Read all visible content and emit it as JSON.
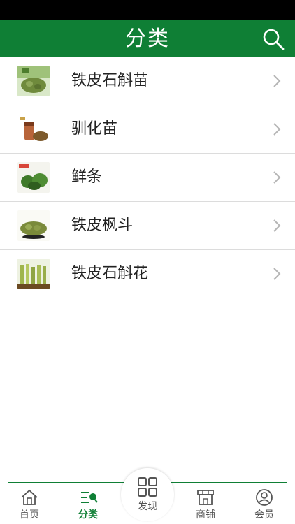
{
  "header": {
    "title": "分类"
  },
  "categories": [
    {
      "label": "铁皮石斛苗"
    },
    {
      "label": "驯化苗"
    },
    {
      "label": "鲜条"
    },
    {
      "label": "铁皮枫斗"
    },
    {
      "label": "铁皮石斛花"
    }
  ],
  "tabbar": {
    "items": [
      {
        "label": "首页"
      },
      {
        "label": "分类"
      },
      {
        "label": "发现"
      },
      {
        "label": "商铺"
      },
      {
        "label": "会员"
      }
    ]
  },
  "colors": {
    "brand": "#0f7f35"
  }
}
